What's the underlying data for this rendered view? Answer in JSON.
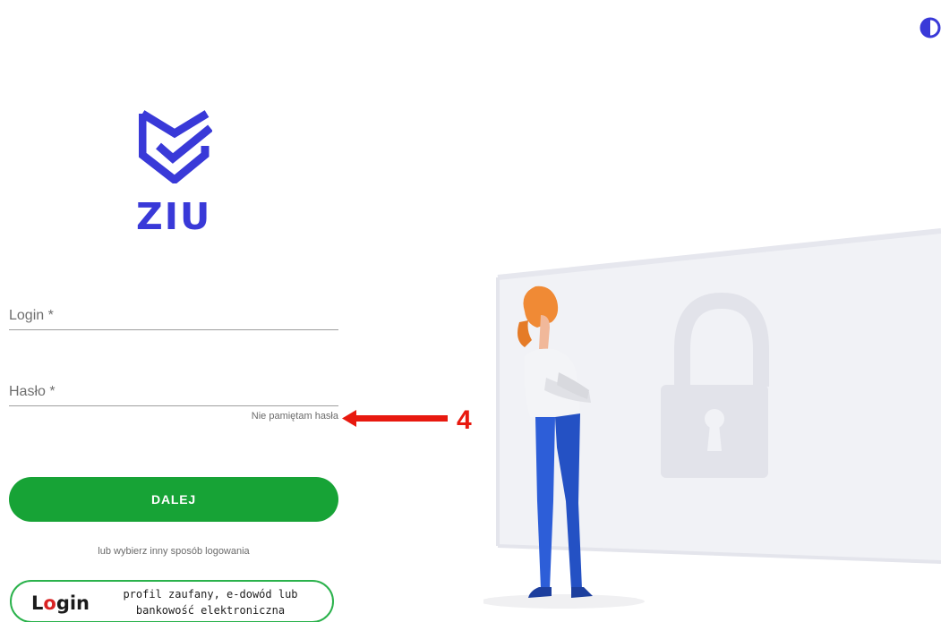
{
  "app": {
    "logo_text": "ZIU",
    "brand_color": "#3939d8"
  },
  "accessibility": {
    "contrast_icon": "contrast-half-circle-icon"
  },
  "form": {
    "login_placeholder": "Login *",
    "password_placeholder": "Hasło *",
    "forgot_password": "Nie pamiętam hasła",
    "submit_label": "DALEJ",
    "submit_color": "#17a336",
    "alt_login_text": "lub wybierz inny sposób logowania"
  },
  "login_gov": {
    "logo_prefix": "L",
    "logo_o": "o",
    "logo_suffix": "gin",
    "line1": "profil zaufany, e-dowód lub",
    "line2": "bankowość elektroniczna",
    "border_color": "#2bb24c"
  },
  "annotation": {
    "number": "4",
    "color": "#e8190f"
  },
  "illustration": {
    "icons": [
      "padlock-icon",
      "standing-person-icon"
    ]
  }
}
